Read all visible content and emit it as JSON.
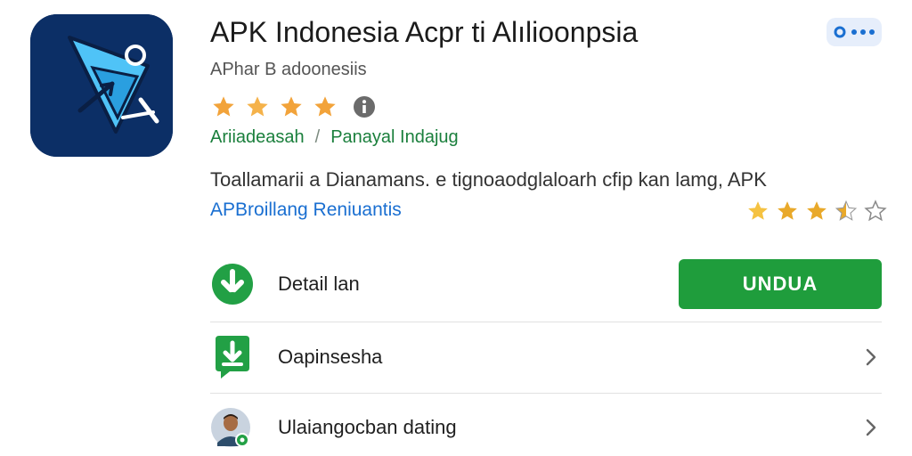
{
  "app": {
    "title": "APK Indonesia Acpr ti Alılioonpsia",
    "developer": "APhar B adoonesiis",
    "rating_stars": 4,
    "category": "Ariiadeasah",
    "category_sub": "Panayal Indajug",
    "separator": "/",
    "description": "Toallamarii a Dianamans. e tignoaodglaloarh cfip kan  lamg, APK",
    "more_link": "APBroillang Reniuantis",
    "review_stars": 3.5
  },
  "more_button": {
    "label": "more-options",
    "icon": "ellipsis-icon"
  },
  "rows": [
    {
      "label": "Detail lan",
      "icon": "download-icon",
      "action_label": "UNDUA"
    },
    {
      "label": "Oapinsesha",
      "icon": "download-box-icon"
    },
    {
      "label": "Ulaiangocban dating",
      "icon": "avatar"
    }
  ],
  "colors": {
    "accent_green": "#1f9d3c",
    "link_blue": "#1a6fd1",
    "star_orange": "#f2a33a",
    "icon_navy": "#0c2f66"
  }
}
